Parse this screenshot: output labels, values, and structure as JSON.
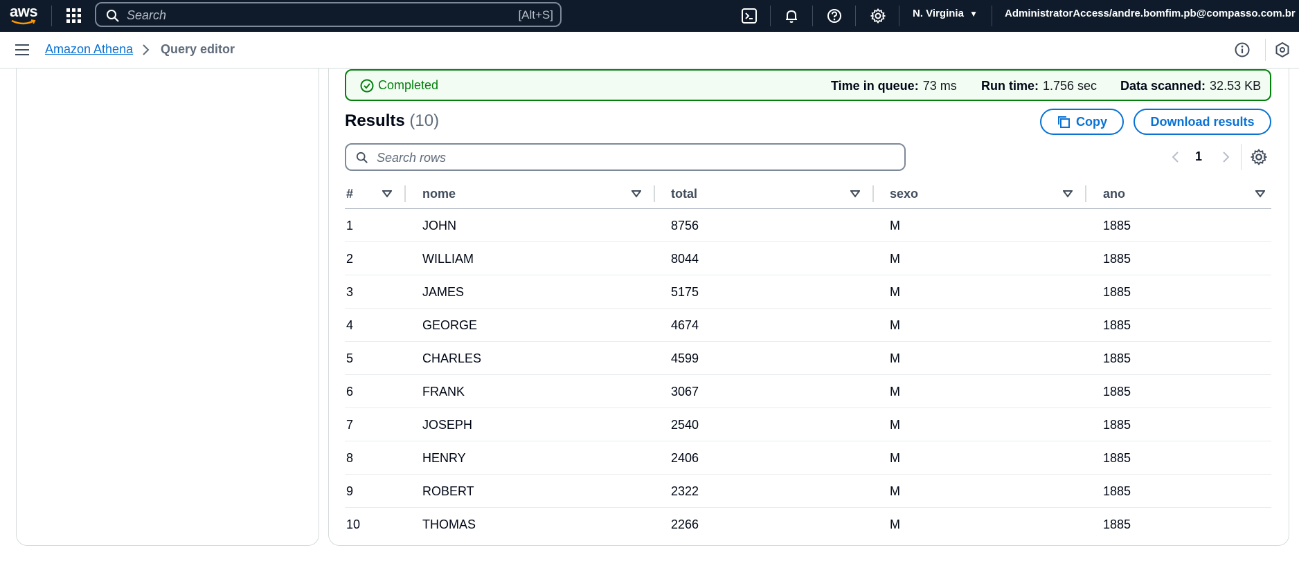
{
  "topnav": {
    "logo_text": "aws",
    "search_placeholder": "Search",
    "search_shortcut": "[Alt+S]",
    "icons": [
      "cloudshell-icon",
      "bell-icon",
      "help-icon",
      "gear-icon"
    ],
    "region": "N. Virginia",
    "account": "AdministratorAccess/andre.bomfim.pb@compasso.com.br"
  },
  "breadcrumb": {
    "service": "Amazon Athena",
    "current": "Query editor"
  },
  "status": {
    "label": "Completed",
    "queue_label": "Time in queue:",
    "queue_value": "73 ms",
    "runtime_label": "Run time:",
    "runtime_value": "1.756 sec",
    "scanned_label": "Data scanned:",
    "scanned_value": "32.53 KB"
  },
  "results": {
    "title": "Results",
    "count": "(10)",
    "copy_label": "Copy",
    "download_label": "Download results",
    "search_placeholder": "Search rows",
    "page": "1"
  },
  "table": {
    "columns": [
      "#",
      "nome",
      "total",
      "sexo",
      "ano"
    ],
    "rows": [
      [
        "1",
        "JOHN",
        "8756",
        "M",
        "1885"
      ],
      [
        "2",
        "WILLIAM",
        "8044",
        "M",
        "1885"
      ],
      [
        "3",
        "JAMES",
        "5175",
        "M",
        "1885"
      ],
      [
        "4",
        "GEORGE",
        "4674",
        "M",
        "1885"
      ],
      [
        "5",
        "CHARLES",
        "4599",
        "M",
        "1885"
      ],
      [
        "6",
        "FRANK",
        "3067",
        "M",
        "1885"
      ],
      [
        "7",
        "JOSEPH",
        "2540",
        "M",
        "1885"
      ],
      [
        "8",
        "HENRY",
        "2406",
        "M",
        "1885"
      ],
      [
        "9",
        "ROBERT",
        "2322",
        "M",
        "1885"
      ],
      [
        "10",
        "THOMAS",
        "2266",
        "M",
        "1885"
      ]
    ]
  },
  "colors": {
    "nav_bg": "#0f1b2a",
    "link": "#0972d3",
    "success": "#037f0c",
    "success_bg": "#f2fcf3"
  }
}
